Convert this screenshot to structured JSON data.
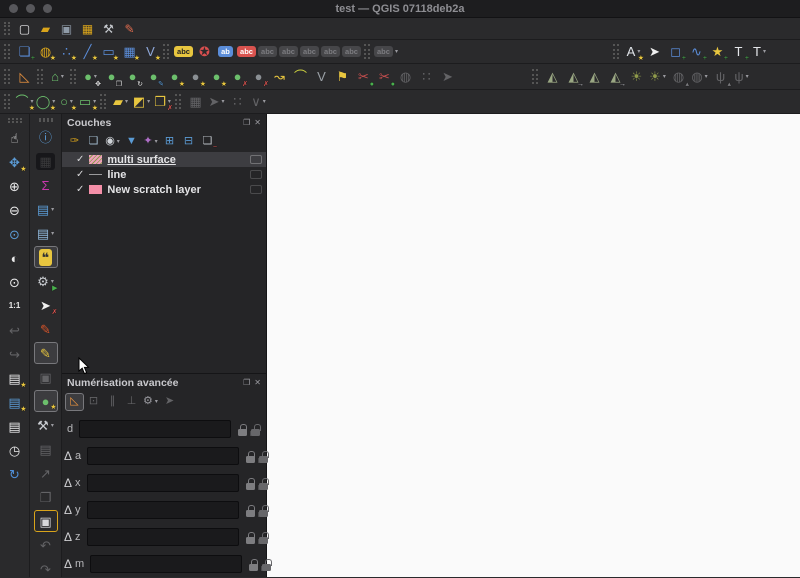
{
  "window": {
    "title": "test — QGIS 07118deb2a",
    "traffic_lights": [
      "close",
      "minimize",
      "zoom"
    ]
  },
  "colors": {
    "titlebar_bg": "#1d1d1f",
    "toolbar_bg": "#2a2a2c",
    "panel_bg": "#252527",
    "canvas_bg": "#fafafa",
    "accent_yellow": "#e8c63f",
    "accent_blue": "#5b8dd9",
    "accent_green": "#6cbf6c",
    "accent_red": "#d9534f",
    "selected_row": "#3d3d41"
  },
  "toolbars": [
    {
      "name": "project-toolbar",
      "groups": [
        {
          "name": "project",
          "items": [
            {
              "n": "new-project",
              "g": "▢",
              "c": "#e8e8ea"
            },
            {
              "n": "open-project",
              "g": "▰",
              "c": "#d9a41b"
            },
            {
              "n": "save-project",
              "g": "▣",
              "c": "#8f9ba8"
            },
            {
              "n": "save-project-as",
              "g": "▦",
              "c": "#d9a41b"
            },
            {
              "n": "layout-manager",
              "g": "⚒",
              "c": "#c9ccd1"
            },
            {
              "n": "style-manager",
              "g": "✎",
              "c": "#e06c4e"
            }
          ]
        }
      ]
    },
    {
      "name": "layers-labels-annotations-toolbar",
      "groups": [
        {
          "name": "add-layers",
          "items": [
            {
              "n": "data-source-manager",
              "g": "❏",
              "c": "#5b8dd9",
              "b": "+",
              "bc": "#49b04d"
            },
            {
              "n": "new-geopackage-layer",
              "g": "◍",
              "c": "#d9a41b",
              "b": "★",
              "bc": "#e8c63f"
            },
            {
              "n": "new-point-layer",
              "g": "∴",
              "c": "#5b8dd9",
              "b": "★",
              "bc": "#e8c63f"
            },
            {
              "n": "new-line-layer",
              "g": "╱",
              "c": "#5b8dd9",
              "b": "★",
              "bc": "#e8c63f"
            },
            {
              "n": "new-polygon-layer",
              "g": "▭",
              "c": "#5b8dd9",
              "b": "★",
              "bc": "#e8c63f"
            },
            {
              "n": "new-mesh-layer",
              "g": "▦",
              "c": "#5b8dd9",
              "b": "★",
              "bc": "#e8c63f"
            },
            {
              "n": "new-virtual-layer",
              "g": "V",
              "c": "#8fa8d9",
              "b": "★",
              "bc": "#e8c63f"
            }
          ]
        },
        {
          "name": "labeling",
          "items": [
            {
              "n": "layer-labeling-options",
              "g": "abc",
              "pill": 1,
              "bg": "#e8c63f",
              "c": "#222"
            },
            {
              "n": "layer-diagram-options",
              "g": "✪",
              "c": "#d94f4f"
            },
            {
              "n": "labeling-single",
              "g": "ab",
              "pill": 1,
              "bg": "#5b8dd9",
              "c": "#fff"
            },
            {
              "n": "labeling-rule-based",
              "g": "abc",
              "pill": 1,
              "bg": "#d9534f",
              "c": "#fff"
            },
            {
              "n": "label-tool-1",
              "g": "abc",
              "pill": 1,
              "dis": 1
            },
            {
              "n": "label-tool-2",
              "g": "abc",
              "pill": 1,
              "dis": 1
            },
            {
              "n": "label-tool-3",
              "g": "abc",
              "pill": 1,
              "dis": 1
            },
            {
              "n": "label-tool-4",
              "g": "abc",
              "pill": 1,
              "dis": 1
            },
            {
              "n": "label-tool-5",
              "g": "abc",
              "pill": 1,
              "dis": 1
            }
          ]
        },
        {
          "name": "labeling-extra",
          "items": [
            {
              "n": "label-tool-6",
              "g": "abc",
              "pill": 1,
              "dis": 1,
              "dd": 1
            }
          ]
        },
        {
          "name": "annotations",
          "right": true,
          "items": [
            {
              "n": "main-annotation-layer",
              "g": "A",
              "c": "#dfe3e8",
              "b": "★",
              "bc": "#e8c63f",
              "dd": 1
            },
            {
              "n": "select-annotation",
              "g": "➤",
              "c": "#f0f0f0"
            },
            {
              "n": "polygon-annotation",
              "g": "◻",
              "c": "#5b8dd9",
              "b": "+",
              "bc": "#49b04d"
            },
            {
              "n": "line-annotation",
              "g": "∿",
              "c": "#5b8dd9",
              "b": "+",
              "bc": "#49b04d"
            },
            {
              "n": "marker-annotation",
              "g": "★",
              "c": "#e8c63f",
              "b": "+",
              "bc": "#49b04d"
            },
            {
              "n": "text-annotation",
              "g": "T",
              "c": "#e4e6ea",
              "b": "+",
              "bc": "#49b04d"
            },
            {
              "n": "form-annotation",
              "g": "T",
              "c": "#e4e6ea",
              "dd": 1
            }
          ]
        }
      ]
    },
    {
      "name": "digitizing-mesh-toolbar",
      "groups": [
        {
          "name": "cad",
          "items": [
            {
              "n": "cad-tools",
              "g": "◺",
              "c": "#e8923f"
            }
          ]
        },
        {
          "name": "digitize-shape",
          "items": [
            {
              "n": "digitize-with-shape",
              "g": "⌂",
              "c": "#6cbf6c",
              "dd": 1
            }
          ]
        },
        {
          "name": "advanced-digitizing",
          "items": [
            {
              "n": "move-feature",
              "g": "●",
              "c": "#6cbf6c",
              "b": "✥",
              "bc": "#e9e9ea",
              "dd": 1
            },
            {
              "n": "copy-move-feature",
              "g": "●",
              "c": "#6cbf6c",
              "b": "❐",
              "bc": "#e9e9ea"
            },
            {
              "n": "rotate-feature",
              "g": "●",
              "c": "#6cbf6c",
              "b": "↻",
              "bc": "#e9e9ea"
            },
            {
              "n": "simplify-feature",
              "g": "●",
              "c": "#6cbf6c",
              "b": "✎",
              "bc": "#5b9bd5"
            },
            {
              "n": "add-ring",
              "g": "●",
              "c": "#6cbf6c",
              "b": "★",
              "bc": "#e8c63f"
            },
            {
              "n": "add-part",
              "g": "●",
              "c": "#8a8f94",
              "b": "★",
              "bc": "#e8c63f"
            },
            {
              "n": "fill-ring",
              "g": "●",
              "c": "#6cbf6c",
              "b": "★",
              "bc": "#e8c63f"
            },
            {
              "n": "delete-ring",
              "g": "●",
              "c": "#6cbf6c",
              "b": "✗",
              "bc": "#d9534f"
            },
            {
              "n": "delete-part",
              "g": "●",
              "c": "#8a8f94",
              "b": "✗",
              "bc": "#d9534f"
            },
            {
              "n": "reshape-features",
              "g": "↝",
              "c": "#e8c63f"
            },
            {
              "n": "offset-curve",
              "g": "⌒",
              "c": "#cdd13f"
            },
            {
              "n": "vertex-tool-all",
              "g": "V",
              "c": "#9aa0a6"
            },
            {
              "n": "trace",
              "g": "⚑",
              "c": "#e8c63f"
            },
            {
              "n": "split-features",
              "g": "✂",
              "c": "#c94f4f",
              "b": "●",
              "bc": "#49b04d"
            },
            {
              "n": "split-parts",
              "g": "✂",
              "c": "#c94f4f",
              "b": "●",
              "bc": "#49b04d"
            },
            {
              "n": "merge-features",
              "g": "◍",
              "dis": 1
            },
            {
              "n": "merge-attributes",
              "g": "∷",
              "dis": 1
            },
            {
              "n": "trim-extend",
              "g": "➤",
              "dis": 1
            }
          ]
        },
        {
          "name": "mesh-digitizing",
          "right": true,
          "items": [
            {
              "n": "mesh-digitize",
              "g": "◭",
              "c": "#9aa783"
            },
            {
              "n": "mesh-select-by-polygon",
              "g": "◭",
              "c": "#9aa783",
              "b": "→",
              "bc": "#c9ccd1"
            },
            {
              "n": "mesh-transform",
              "g": "◭",
              "c": "#9aa783"
            },
            {
              "n": "mesh-transform-move",
              "g": "◭",
              "c": "#9aa783",
              "b": "→",
              "bc": "#c9ccd1"
            },
            {
              "n": "mesh-reindex",
              "g": "☀",
              "c": "#8f9a4a"
            },
            {
              "n": "mesh-reindex-options",
              "g": "☀",
              "c": "#8f9a4a",
              "dd": 1
            },
            {
              "n": "mesh-force-1",
              "g": "◍",
              "dis": 1,
              "b": "▴",
              "bc": "#7a7a7e"
            },
            {
              "n": "mesh-force-2",
              "g": "◍",
              "dis": 1,
              "dd": 1
            },
            {
              "n": "mesh-branch-1",
              "g": "ψ",
              "dis": 1,
              "b": "▴",
              "bc": "#7a7a7e"
            },
            {
              "n": "mesh-branch-2",
              "g": "ψ",
              "dis": 1,
              "dd": 1
            }
          ]
        }
      ]
    },
    {
      "name": "shape-digitizing-toolbar",
      "groups": [
        {
          "name": "curves",
          "items": [
            {
              "n": "circular-string",
              "g": "⌒",
              "c": "#6cbf6c",
              "b": "★",
              "bc": "#e8c63f",
              "dd": 1
            },
            {
              "n": "circle",
              "g": "◯",
              "c": "#6cbf6c",
              "b": "★",
              "bc": "#e8c63f",
              "dd": 1
            },
            {
              "n": "ellipse",
              "g": "○",
              "c": "#6cbf6c",
              "b": "★",
              "bc": "#e8c63f",
              "dd": 1
            },
            {
              "n": "rectangle",
              "g": "▭",
              "c": "#6cbf6c",
              "b": "★",
              "bc": "#e8c63f",
              "dd": 1
            }
          ]
        },
        {
          "name": "regular-shapes",
          "items": [
            {
              "n": "regular-polygon",
              "g": "▰",
              "c": "#e8c63f",
              "dd": 1
            },
            {
              "n": "fill-triangle",
              "g": "◩",
              "c": "#e8c63f",
              "dd": 1
            },
            {
              "n": "copy-paste-features",
              "g": "❐",
              "c": "#e8c63f",
              "b": "✗",
              "bc": "#d9534f",
              "dd": 1
            }
          ]
        },
        {
          "name": "disabled-shape-tools",
          "items": [
            {
              "n": "grid-tool",
              "g": "▦",
              "dis": 1
            },
            {
              "n": "select-shape-tool",
              "g": "➤",
              "dis": 1,
              "dd": 1
            },
            {
              "n": "dots-tool",
              "g": "∷",
              "dis": 1
            },
            {
              "n": "node-shape-tool",
              "g": "∨",
              "dis": 1,
              "dd": 1
            }
          ]
        }
      ]
    }
  ],
  "sidebar": {
    "nav": {
      "name": "map-navigation-toolbar",
      "items": [
        {
          "n": "pan-map",
          "g": "☝",
          "c": "#e9e9ea"
        },
        {
          "n": "pan-to-selection",
          "g": "✥",
          "c": "#5b9bd5",
          "b": "★",
          "bc": "#e8c63f"
        },
        {
          "n": "zoom-in",
          "g": "⊕",
          "c": "#e9e9ea"
        },
        {
          "n": "zoom-out",
          "g": "⊖",
          "c": "#e9e9ea"
        },
        {
          "n": "zoom-to-selection",
          "g": "⊙",
          "c": "#5b9bd5"
        },
        {
          "n": "zoom-to-layer",
          "g": "◐",
          "c": "#e9e9ea"
        },
        {
          "n": "zoom-full",
          "g": "⊙",
          "c": "#e9e9ea"
        },
        {
          "n": "zoom-native",
          "g": "1:1",
          "c": "#e9e9ea",
          "small": 1
        },
        {
          "n": "zoom-last",
          "g": "↩",
          "dis": 1
        },
        {
          "n": "zoom-next",
          "g": "↪",
          "dis": 1
        },
        {
          "n": "new-bookmark",
          "g": "▤",
          "c": "#e9e9ea",
          "b": "★",
          "bc": "#e8c63f"
        },
        {
          "n": "show-bookmarks",
          "g": "▤",
          "c": "#5b9bd5",
          "b": "★",
          "bc": "#e8c63f"
        },
        {
          "n": "bookmark-manager",
          "g": "▤",
          "c": "#e9e9ea"
        },
        {
          "n": "temporal-controller",
          "g": "◷",
          "c": "#e9e9ea"
        },
        {
          "n": "refresh-map",
          "g": "↻",
          "c": "#4f8fd9"
        }
      ]
    },
    "attributes": {
      "name": "attributes-editing-toolbar",
      "items": [
        {
          "n": "identify-features",
          "g": "ⓘ",
          "c": "#5b9bd5"
        },
        {
          "n": "select-by-form",
          "g": "▦",
          "c": "#3a3a3c",
          "bg": "#17171a"
        },
        {
          "n": "statistics",
          "g": "Σ",
          "c": "#c837ab"
        },
        {
          "n": "attribute-table",
          "g": "▤",
          "c": "#5b9bd5",
          "dd": 1
        },
        {
          "n": "attribute-table-alt",
          "g": "▤",
          "c": "#8fb6d9",
          "dd": 1
        },
        {
          "n": "map-tips",
          "g": "❝",
          "bg": "#e8c63f",
          "c": "#333",
          "act": 1
        },
        {
          "n": "processing-toolbox",
          "g": "⚙",
          "c": "#c9ccd1",
          "b": "▶",
          "bc": "#49b04d",
          "dd": 1
        },
        {
          "n": "deselect-features",
          "g": "➤",
          "c": "#f0f0f0",
          "b": "✗",
          "bc": "#d9534f"
        },
        {
          "n": "current-edits",
          "g": "✎",
          "c": "#d9542a"
        },
        {
          "n": "toggle-editing",
          "g": "✎",
          "c": "#e8c63f",
          "act": 1
        },
        {
          "n": "save-edits",
          "g": "▣",
          "dis": 1
        },
        {
          "n": "add-polygon-feature",
          "g": "●",
          "c": "#6cbf6c",
          "b": "★",
          "bc": "#e8c63f",
          "act": 1
        },
        {
          "n": "vertex-tool",
          "g": "⚒",
          "c": "#c9ccd1",
          "dd": 1
        },
        {
          "n": "modify-attributes",
          "g": "▤",
          "dis": 1
        },
        {
          "n": "trim-extend-feature",
          "g": "↗",
          "dis": 1
        },
        {
          "n": "copy-features",
          "g": "❐",
          "dis": 1
        },
        {
          "n": "paste-features",
          "g": "▣",
          "c": "#d8d8da",
          "foc": 1
        },
        {
          "n": "undo",
          "g": "↶",
          "dis": 1
        },
        {
          "n": "redo",
          "g": "↷",
          "dis": 1
        }
      ]
    }
  },
  "layers_panel": {
    "title": "Couches",
    "float_label": "float",
    "close_label": "close",
    "toolbar": [
      {
        "n": "open-layer-styling",
        "g": "✑",
        "c": "#d9a41b"
      },
      {
        "n": "add-group",
        "g": "❏",
        "c": "#9fb6c9"
      },
      {
        "n": "manage-map-themes",
        "g": "◉",
        "c": "#cfd3d8",
        "dd": 1
      },
      {
        "n": "filter-legend",
        "g": "▼",
        "c": "#5b9bd5"
      },
      {
        "n": "filter-by-expression",
        "g": "✦",
        "c": "#b06fc9",
        "dd": 1
      },
      {
        "n": "expand-all",
        "g": "⊞",
        "c": "#5b9bd5"
      },
      {
        "n": "collapse-all",
        "g": "⊟",
        "c": "#5b9bd5"
      },
      {
        "n": "remove-layer",
        "g": "❏",
        "c": "#b9bec4",
        "b": "−",
        "bc": "#d9534f"
      }
    ],
    "layers": [
      {
        "label": "multi surface",
        "checked": true,
        "swatch": "hatch",
        "selected": true,
        "underline": true,
        "indicator": "memory-layer"
      },
      {
        "label": "line",
        "checked": true,
        "swatch": "line",
        "selected": false,
        "underline": false,
        "indicator": "memory-layer"
      },
      {
        "label": "New scratch layer",
        "checked": true,
        "swatch": "solid",
        "selected": false,
        "underline": false,
        "indicator": "memory-layer"
      }
    ]
  },
  "advanced_panel": {
    "title": "Numérisation avancée",
    "toolbar": [
      {
        "n": "enable-advanced-digitizing",
        "g": "◺",
        "c": "#e8923f",
        "act": 1
      },
      {
        "n": "construction-mode",
        "g": "⊡",
        "dis": 1
      },
      {
        "n": "parallel-constraint",
        "g": "∥",
        "dis": 1
      },
      {
        "n": "perpendicular-constraint",
        "g": "⊥",
        "dis": 1
      },
      {
        "n": "cad-settings",
        "g": "⚙",
        "c": "#9a9aa0",
        "dd": 1
      },
      {
        "n": "cad-floater",
        "g": "➤",
        "dis": 1
      }
    ],
    "fields": [
      {
        "prefix": "",
        "label": "d",
        "value": ""
      },
      {
        "prefix": "Δ",
        "label": "a",
        "value": ""
      },
      {
        "prefix": "Δ",
        "label": "x",
        "value": ""
      },
      {
        "prefix": "Δ",
        "label": "y",
        "value": ""
      },
      {
        "prefix": "Δ",
        "label": "z",
        "value": ""
      },
      {
        "prefix": "Δ",
        "label": "m",
        "value": ""
      }
    ]
  }
}
